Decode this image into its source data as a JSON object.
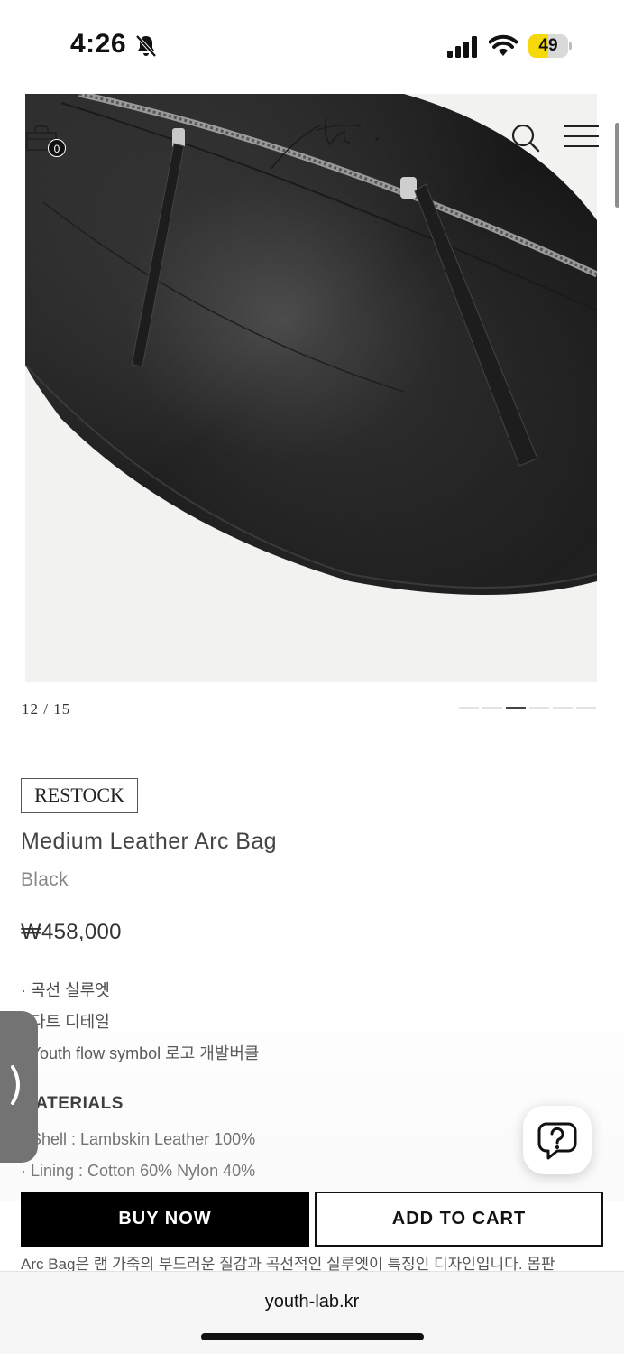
{
  "status_bar": {
    "time": "4:26",
    "battery": "49",
    "battery_level": 0.49,
    "icons": [
      "bell-slash-icon",
      "cellular-signal-icon",
      "wifi-icon",
      "battery-icon"
    ]
  },
  "header": {
    "cart_count": "0",
    "logo_text": "th.",
    "icons": [
      "shopping-bag-icon",
      "search-icon",
      "hamburger-menu-icon"
    ]
  },
  "gallery": {
    "counter": "12 / 15",
    "current": 12,
    "total": 15,
    "indicator_segments": 6,
    "active_segment": 3
  },
  "product": {
    "badge": "RESTOCK",
    "title": "Medium Leather Arc Bag",
    "color": "Black",
    "price": "₩458,000",
    "features": [
      "· 곡선 실루엣",
      "· 다트 디테일",
      "· Youth flow symbol 로고 개발버클"
    ],
    "materials_heading": "MATERIALS",
    "materials": [
      "· Shell : Lambskin Leather 100%",
      "· Lining : Cotton 60% Nylon 40%"
    ],
    "description": "Arc Bag은 램 가죽의 부드러운 질감과 곡선적인 실루엣이 특징인 디자인입니다. 몸판"
  },
  "actions": {
    "buy_now": "BUY NOW",
    "add_to_cart": "ADD TO CART"
  },
  "help_icon": "question-chat-icon",
  "side_tab_icon": "chevron-right-icon",
  "browser": {
    "url": "youth-lab.kr"
  },
  "colors": {
    "battery_fill": "#f5d90a",
    "button_primary": "#000000",
    "side_tab": "#737373"
  }
}
